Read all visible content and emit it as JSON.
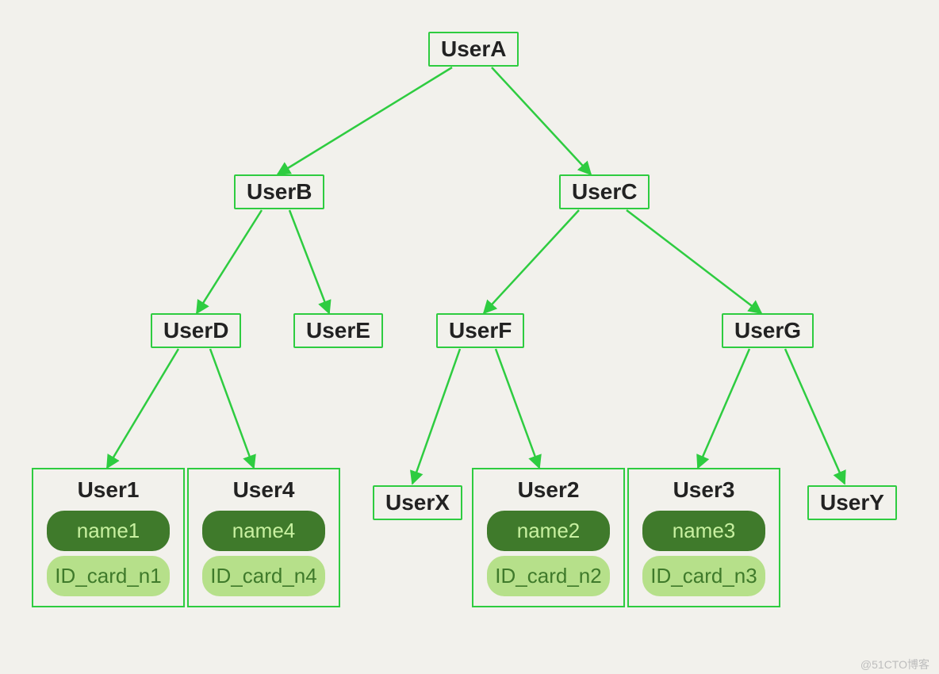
{
  "colors": {
    "outline": "#2ecc40",
    "pill_dark_bg": "#3f7a2b",
    "pill_dark_fg": "#c8f0a0",
    "pill_light_bg": "#b6e08a",
    "pill_light_fg": "#3f7a2b",
    "background": "#f2f1ec"
  },
  "watermark": "@51CTO博客",
  "nodes": {
    "userA": "UserA",
    "userB": "UserB",
    "userC": "UserC",
    "userD": "UserD",
    "userE": "UserE",
    "userF": "UserF",
    "userG": "UserG",
    "userX": "UserX",
    "userY": "UserY"
  },
  "leaves": {
    "user1": {
      "title": "User1",
      "name": "name1",
      "id": "ID_card_n1"
    },
    "user4": {
      "title": "User4",
      "name": "name4",
      "id": "ID_card_n4"
    },
    "user2": {
      "title": "User2",
      "name": "name2",
      "id": "ID_card_n2"
    },
    "user3": {
      "title": "User3",
      "name": "name3",
      "id": "ID_card_n3"
    }
  },
  "edges": [
    [
      "userA",
      "userB"
    ],
    [
      "userA",
      "userC"
    ],
    [
      "userB",
      "userD"
    ],
    [
      "userB",
      "userE"
    ],
    [
      "userC",
      "userF"
    ],
    [
      "userC",
      "userG"
    ],
    [
      "userD",
      "user1"
    ],
    [
      "userD",
      "user4"
    ],
    [
      "userF",
      "userX"
    ],
    [
      "userF",
      "user2"
    ],
    [
      "userG",
      "user3"
    ],
    [
      "userG",
      "userY"
    ]
  ]
}
